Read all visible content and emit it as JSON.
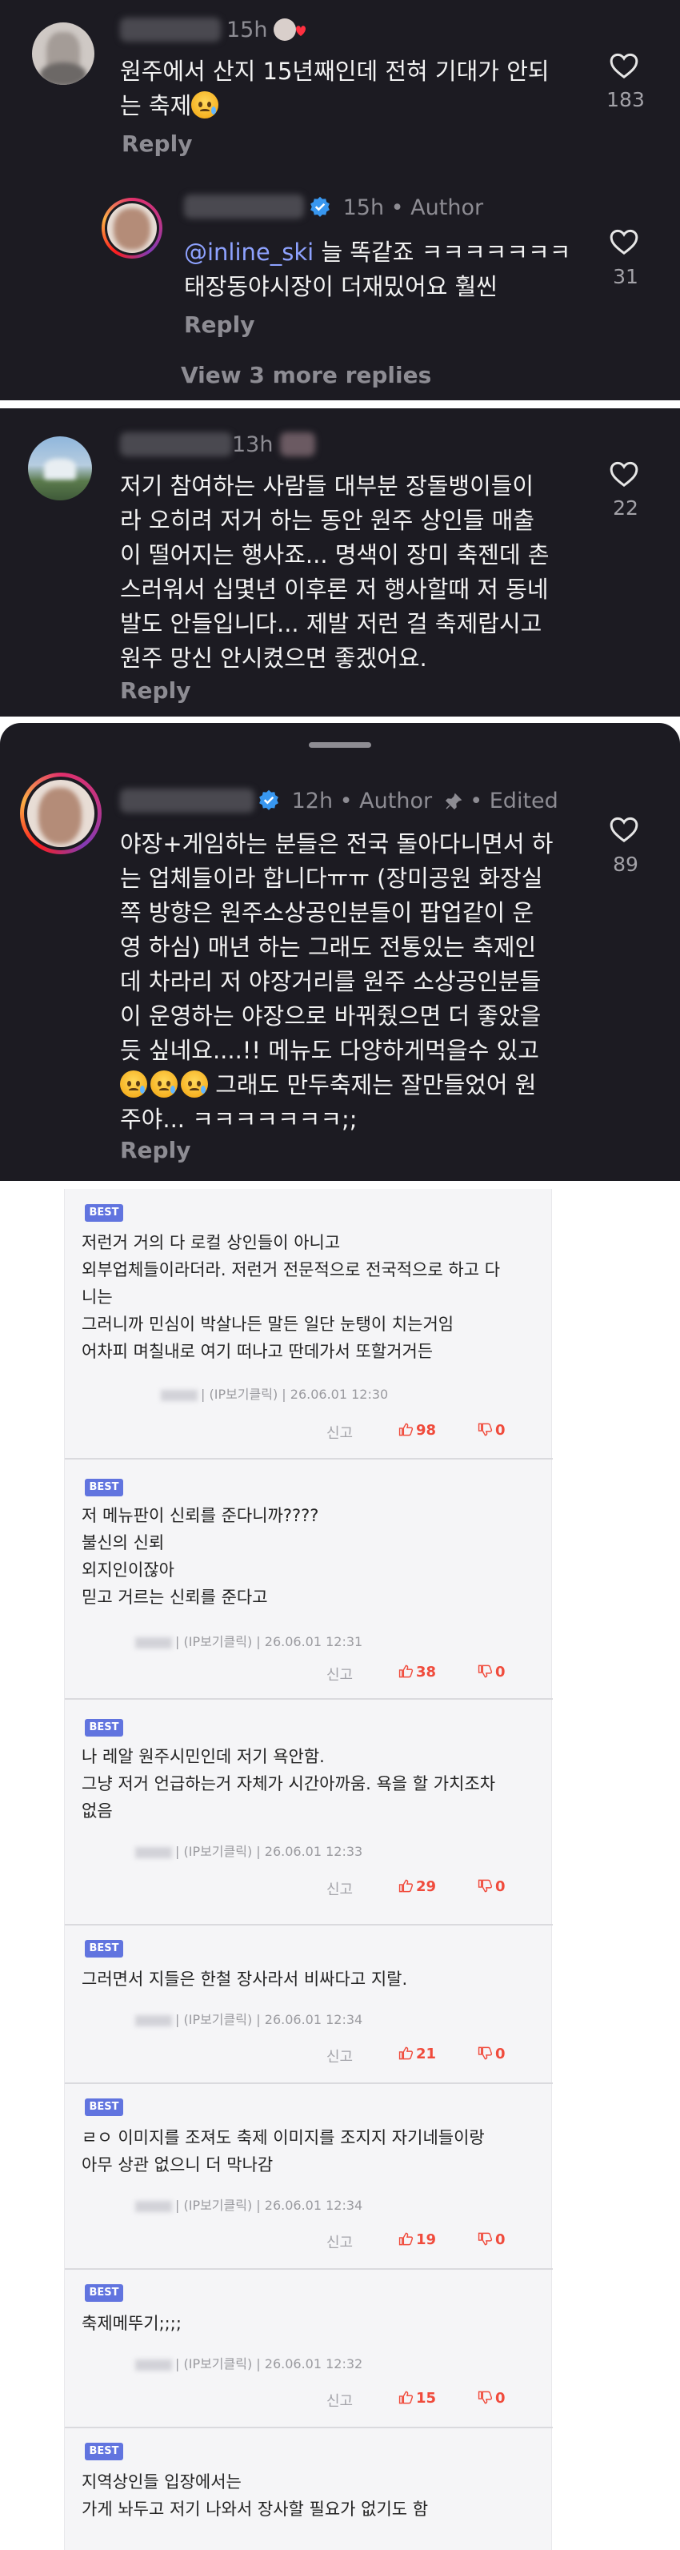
{
  "comments": [
    {
      "time": "15h",
      "text_lines": [
        "원주에서 산지 15년째인데 전혀 기대가 안되",
        "는 축제"
      ],
      "reply_label": "Reply",
      "likes": "183"
    },
    {
      "time": "15h",
      "author_badge": "Author",
      "mention": "@inline_ski",
      "text_lines": [
        "늘 똑같죠 ㅋㅋㅋㅋㅋㅋㅋ",
        "태장동야시장이 더재밌어요 훨씬"
      ],
      "reply_label": "Reply",
      "likes": "31",
      "view_more": "View 3 more replies"
    },
    {
      "time": "13h",
      "text_lines": [
        "저기 참여하는 사람들 대부분 장돌뱅이들이",
        "라 오히려 저거 하는 동안 원주 상인들 매출",
        "이 떨어지는 행사죠... 명색이 장미 축젠데 촌",
        "스러워서 십몇년 이후론 저 행사할때 저 동네",
        "발도 안들입니다... 제발 저런 걸 축제랍시고",
        "원주 망신 안시켰으면 좋겠어요."
      ],
      "reply_label": "Reply",
      "likes": "22"
    },
    {
      "time": "12h",
      "author_badge": "Author",
      "edited": "Edited",
      "text_lines": [
        "야장+게임하는 분들은 전국 돌아다니면서 하",
        "는 업체들이라 합니다ㅠㅠ (장미공원 화장실",
        "쪽 방향은 원주소상공인분들이 팝업같이 운",
        "영 하심) 매년 하는 그래도 전통있는 축제인",
        "데 차라리 저 야장거리를 원주 소상공인분들",
        "이 운영하는 야장으로 바꿔줬으면 더 좋았을",
        "듯 싶네요....!! 메뉴도 다양하게먹을수 있고",
        " 그래도 만두축제는 잘만들었어 원",
        "주야... ㅋㅋㅋㅋㅋㅋㅋ;;"
      ],
      "reply_label": "Reply",
      "likes": "89"
    }
  ],
  "board": {
    "best_label": "BEST",
    "report_label": "신고",
    "items": [
      {
        "lines": [
          "저런거 거의 다 로컬 상인들이 아니고",
          "외부업체들이라더라. 저런거 전문적으로 전국적으로 하고 다",
          "니는",
          "그러니까 민심이 박살나든 말든 일단 눈탱이 치는거임",
          "어차피 며칠내로 여기 떠나고 딴데가서 또할거거든"
        ],
        "meta": "| (IP보기클릭) | 26.06.01 12:30",
        "up": "98",
        "down": "0"
      },
      {
        "lines": [
          "저 메뉴판이 신뢰를 준다니까????",
          "불신의 신뢰",
          "외지인이잖아",
          "믿고 거르는 신뢰를 준다고"
        ],
        "meta": "| (IP보기클릭) | 26.06.01 12:31",
        "up": "38",
        "down": "0"
      },
      {
        "lines": [
          "나 레알 원주시민인데 저기 욕안함.",
          "그냥 저거 언급하는거 자체가 시간아까움. 욕을 할 가치조차",
          "없음"
        ],
        "meta": "| (IP보기클릭) | 26.06.01 12:33",
        "up": "29",
        "down": "0"
      },
      {
        "lines": [
          "그러면서 지들은 한철 장사라서 비싸다고 지랄."
        ],
        "meta": "| (IP보기클릭) | 26.06.01 12:34",
        "up": "21",
        "down": "0"
      },
      {
        "lines": [
          "ㄹㅇ 이미지를 조져도 축제 이미지를 조지지 자기네들이랑",
          "아무 상관 없으니 더 막나감"
        ],
        "meta": "| (IP보기클릭) | 26.06.01 12:34",
        "up": "19",
        "down": "0"
      },
      {
        "lines": [
          "축제메뚜기;;;;"
        ],
        "meta": "| (IP보기클릭) | 26.06.01 12:32",
        "up": "15",
        "down": "0"
      },
      {
        "lines": [
          "지역상인들 입장에서는",
          "가게 놔두고 저기 나와서 장사할 필요가 없기도 함"
        ],
        "meta": "",
        "up": "",
        "down": ""
      }
    ]
  }
}
